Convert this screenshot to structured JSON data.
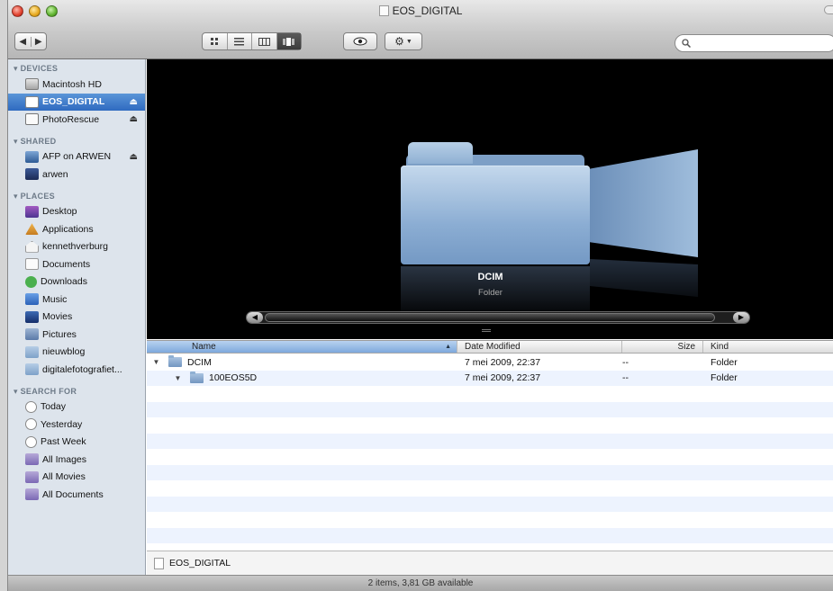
{
  "window": {
    "title": "EOS_DIGITAL"
  },
  "toolbar": {
    "back_icon": "◀",
    "forward_icon": "▶",
    "view_icons": [
      "icon-view",
      "list-view",
      "column-view",
      "coverflow-view"
    ],
    "quicklook_icon": "eye-icon",
    "action_icon": "gear-icon",
    "search_placeholder": ""
  },
  "sidebar": {
    "devices": {
      "heading": "▾ DEVICES",
      "items": [
        {
          "label": "Macintosh HD",
          "icon": "harddisk-icon"
        },
        {
          "label": "EOS_DIGITAL",
          "icon": "disk-icon",
          "eject": "⏏"
        },
        {
          "label": "PhotoRescue",
          "icon": "disk-icon",
          "eject": "⏏"
        }
      ]
    },
    "shared": {
      "heading": "▾ SHARED",
      "items": [
        {
          "label": "AFP on ARWEN",
          "icon": "network-icon",
          "eject": "⏏"
        },
        {
          "label": "arwen",
          "icon": "computer-icon"
        }
      ]
    },
    "places": {
      "heading": "▾ PLACES",
      "items": [
        {
          "label": "Desktop",
          "icon": "desktop-icon"
        },
        {
          "label": "Applications",
          "icon": "applications-icon"
        },
        {
          "label": "kennethverburg",
          "icon": "home-icon"
        },
        {
          "label": "Documents",
          "icon": "documents-icon"
        },
        {
          "label": "Downloads",
          "icon": "downloads-icon"
        },
        {
          "label": "Music",
          "icon": "music-icon"
        },
        {
          "label": "Movies",
          "icon": "movies-icon"
        },
        {
          "label": "Pictures",
          "icon": "pictures-icon"
        },
        {
          "label": "nieuwblog",
          "icon": "folder-icon"
        },
        {
          "label": "digitalefotografiet...",
          "icon": "folder-icon"
        }
      ]
    },
    "search_for": {
      "heading": "▾ SEARCH FOR",
      "items": [
        {
          "label": "Today",
          "icon": "clock-icon"
        },
        {
          "label": "Yesterday",
          "icon": "clock-icon"
        },
        {
          "label": "Past Week",
          "icon": "clock-icon"
        },
        {
          "label": "All Images",
          "icon": "smart-folder-icon"
        },
        {
          "label": "All Movies",
          "icon": "smart-folder-icon"
        },
        {
          "label": "All Documents",
          "icon": "smart-folder-icon"
        }
      ]
    }
  },
  "coverflow": {
    "name": "DCIM",
    "kind": "Folder",
    "left_arrow": "◀",
    "right_arrow": "▶"
  },
  "list": {
    "columns": {
      "name": "Name",
      "date": "Date Modified",
      "size": "Size",
      "kind": "Kind"
    },
    "sort_indicator": "▲",
    "rows": [
      {
        "name": "DCIM",
        "date": "7 mei 2009, 22:37",
        "size": "--",
        "kind": "Folder",
        "disclosure": "▼",
        "indent": 0
      },
      {
        "name": "100EOS5D",
        "date": "7 mei 2009, 22:37",
        "size": "--",
        "kind": "Folder",
        "disclosure": "▼",
        "indent": 1
      }
    ]
  },
  "pathbar": {
    "label": "EOS_DIGITAL"
  },
  "status": {
    "text": "2 items, 3,81 GB available"
  }
}
